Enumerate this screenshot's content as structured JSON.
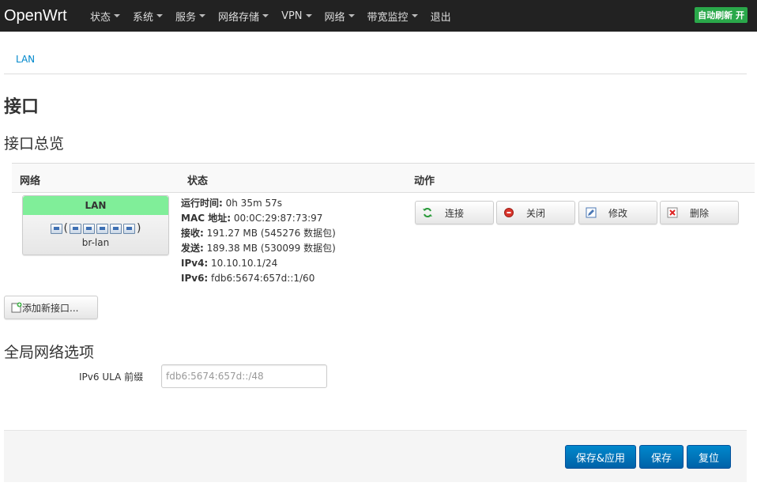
{
  "navbar": {
    "brand": "OpenWrt",
    "menu": [
      "状态",
      "系统",
      "服务",
      "网络存储",
      "VPN",
      "网络",
      "带宽监控",
      "退出"
    ],
    "autorefresh": "自动刷新 开"
  },
  "breadcrumb": {
    "tab": "LAN"
  },
  "page": {
    "title": "接口",
    "section": "接口总览"
  },
  "table": {
    "headers": {
      "network": "网络",
      "status": "状态",
      "action": "动作"
    },
    "iface": {
      "name": "LAN",
      "device": "br-lan",
      "ports_open": "(",
      "ports_close": ")"
    },
    "status": {
      "uptime_label": "运行时间:",
      "uptime": " 0h 35m 57s",
      "mac_label": "MAC 地址:",
      "mac": " 00:0C:29:87:73:97",
      "rx_label": "接收:",
      "rx": " 191.27 MB (545276 数据包)",
      "tx_label": "发送:",
      "tx": " 189.38 MB (530099 数据包)",
      "ipv4_label": "IPv4:",
      "ipv4": " 10.10.10.1/24",
      "ipv6_label": "IPv6:",
      "ipv6": " fdb6:5674:657d::1/60"
    },
    "actions": {
      "connect": "连接",
      "close": "关闭",
      "edit": "修改",
      "delete": "删除"
    }
  },
  "add_iface": "添加新接口...",
  "global": {
    "title": "全局网络选项",
    "ula_label": "IPv6 ULA 前缀",
    "ula_placeholder": "fdb6:5674:657d::/48"
  },
  "footer": {
    "save_apply": "保存&应用",
    "save": "保存",
    "reset": "复位"
  },
  "colors": {
    "navbar": "#222222",
    "iface_header": "#80ee99",
    "primary": "#0088cc",
    "autorefresh": "#2aa84a"
  }
}
